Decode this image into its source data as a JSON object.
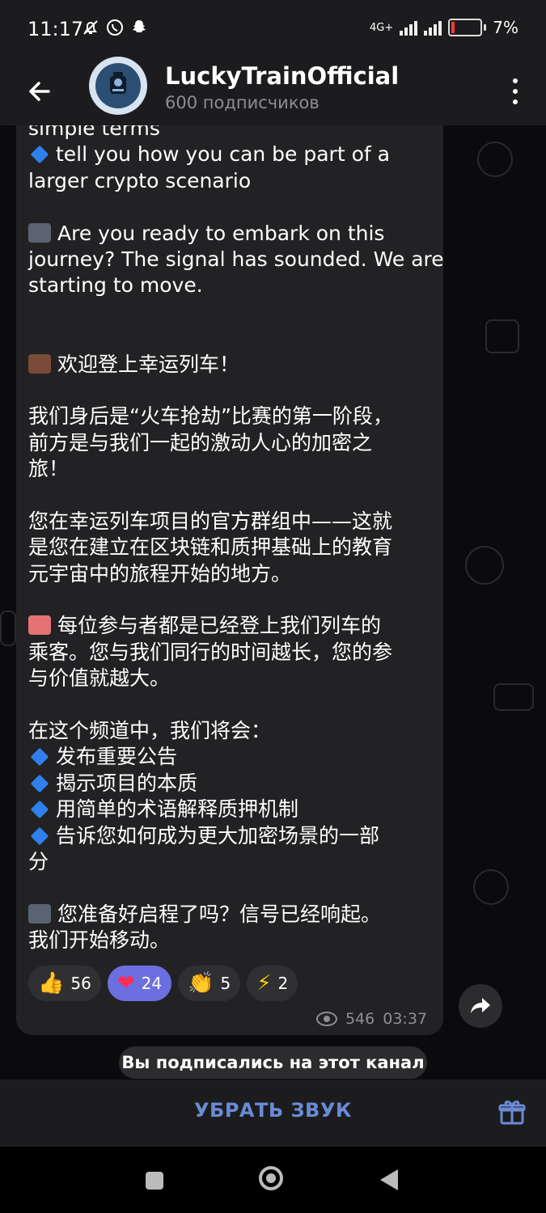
{
  "status_bar": {
    "time": "11:17",
    "network": "4G+",
    "battery": "7%"
  },
  "header": {
    "title": "LuckyTrainOfficial",
    "subtitle": "600 подписчиков"
  },
  "message": {
    "lines": [
      "simple terms",
      "tell you how you can be part of a",
      "larger crypto scenario",
      "",
      "Are you ready to embark on this",
      "journey? The signal has sounded. We are",
      "starting to move.",
      "",
      "",
      "欢迎登上幸运列车！",
      "",
      "我们身后是“火车抢劫”比赛的第一阶段，",
      "前方是与我们一起的激动人心的加密之",
      "旅！",
      "",
      "您在幸运列车项目的官方群组中——这就",
      "是您在建立在区块链和质押基础上的教育",
      "元宇宙中的旅程开始的地方。",
      "",
      "每位参与者都是已经登上我们列车的",
      "乘客。您与我们同行的时间越长，您的参",
      "与价值就越大。",
      "",
      "在这个频道中，我们将会：",
      "发布重要公告",
      "揭示项目的本质",
      "用简单的术语解释质押机制",
      "告诉您如何成为更大加密场景的一部",
      "分",
      "",
      "您准备好启程了吗？信号已经响起。",
      "我们开始移动。"
    ],
    "views": "546",
    "time": "03:37"
  },
  "reactions": [
    {
      "emoji": "👍",
      "count": "56",
      "selected": false
    },
    {
      "emoji": "❤",
      "count": "24",
      "selected": true
    },
    {
      "emoji": "👏",
      "count": "5",
      "selected": false
    },
    {
      "emoji": "⚡",
      "count": "2",
      "selected": false
    }
  ],
  "toast": "Вы подписались на этот канал",
  "bottom": {
    "mute_label": "УБРАТЬ ЗВУК"
  },
  "icons": {
    "back": "arrow-left",
    "menu": "more-vertical",
    "gift": "gift",
    "share": "share-arrow"
  },
  "colors": {
    "accent": "#6a8ad6",
    "selected_reaction": "#6b6fe0",
    "bubble": "#222224",
    "diamond": "#2f80ed"
  }
}
